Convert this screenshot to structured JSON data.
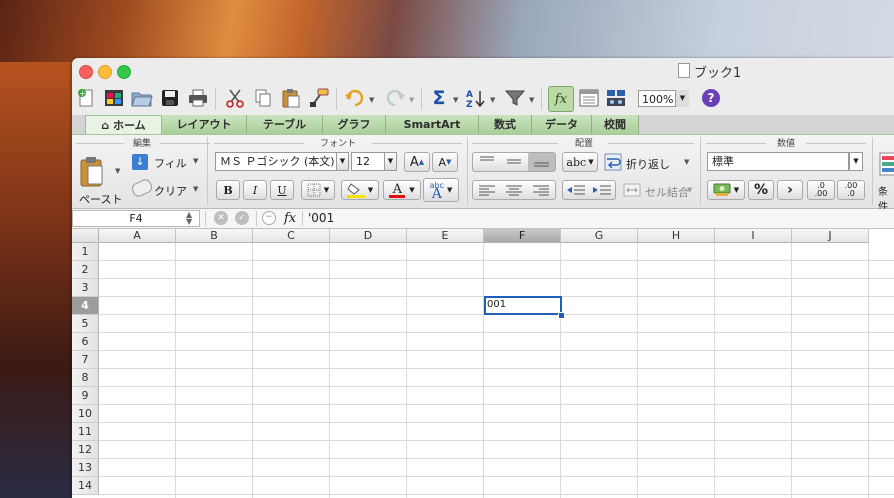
{
  "window": {
    "title": "ブック1"
  },
  "toolbar": {
    "zoom": "100%",
    "help_label": "?"
  },
  "tabs": [
    {
      "label": "ホーム",
      "icon": "home-icon",
      "active": true
    },
    {
      "label": "レイアウト"
    },
    {
      "label": "テーブル"
    },
    {
      "label": "グラフ"
    },
    {
      "label": "SmartArt"
    },
    {
      "label": "数式"
    },
    {
      "label": "データ"
    },
    {
      "label": "校閲"
    }
  ],
  "ribbon": {
    "edit": {
      "title": "編集",
      "paste": "ペースト",
      "fill": "フィル",
      "clear": "クリア"
    },
    "font": {
      "title": "フォント",
      "name": "ＭＳ Ｐゴシック (本文)",
      "size": "12",
      "bold": "B",
      "italic": "I",
      "underline": "U",
      "grow": "A",
      "shrink": "A",
      "color_a": "A",
      "phonetic_top": "abc",
      "phonetic_bottom": "A"
    },
    "align": {
      "title": "配置",
      "wrap": "折り返し",
      "merge": "セル結合",
      "abc": "abc"
    },
    "number": {
      "title": "数値",
      "format": "標準",
      "percent": "%",
      "comma": "›",
      "inc_top": ".0",
      "inc_bottom": ".00",
      "dec_top": ".00",
      "dec_bottom": ".0"
    },
    "conditional": {
      "label": "条件付"
    }
  },
  "formula_bar": {
    "cell_ref": "F4",
    "fx_label": "fx",
    "content": "'001"
  },
  "sheet": {
    "columns": [
      "A",
      "B",
      "C",
      "D",
      "E",
      "F",
      "G",
      "H",
      "I",
      "J"
    ],
    "rows": [
      "1",
      "2",
      "3",
      "4",
      "5",
      "6",
      "7",
      "8",
      "9",
      "10",
      "11",
      "12",
      "13",
      "14"
    ],
    "selected_column": "F",
    "selected_row": "4",
    "active_cell": {
      "ref": "F4",
      "value": "001"
    }
  },
  "colors": {
    "accent": "#1f5fb8",
    "tab_green": "#a9cf98",
    "help_purple": "#6b3fb8"
  }
}
